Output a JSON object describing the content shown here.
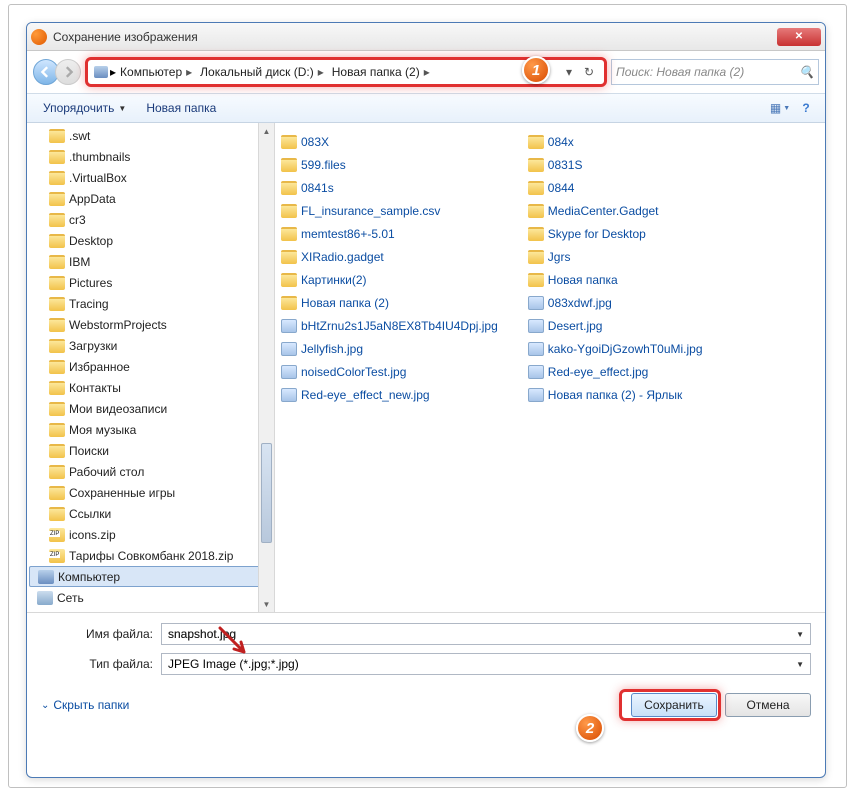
{
  "window": {
    "title": "Сохранение изображения"
  },
  "breadcrumbs": [
    "Компьютер",
    "Локальный диск (D:)",
    "Новая папка (2)"
  ],
  "search": {
    "placeholder": "Поиск: Новая папка (2)"
  },
  "toolbar": {
    "organize": "Упорядочить",
    "new_folder": "Новая папка"
  },
  "tree": [
    {
      "name": ".swt",
      "icon": "folder"
    },
    {
      "name": ".thumbnails",
      "icon": "folder"
    },
    {
      "name": ".VirtualBox",
      "icon": "folder"
    },
    {
      "name": "AppData",
      "icon": "folder"
    },
    {
      "name": "cr3",
      "icon": "folder"
    },
    {
      "name": "Desktop",
      "icon": "folder"
    },
    {
      "name": "IBM",
      "icon": "folder"
    },
    {
      "name": "Pictures",
      "icon": "folder"
    },
    {
      "name": "Tracing",
      "icon": "folder"
    },
    {
      "name": "WebstormProjects",
      "icon": "folder"
    },
    {
      "name": "Загрузки",
      "icon": "folder"
    },
    {
      "name": "Избранное",
      "icon": "folder"
    },
    {
      "name": "Контакты",
      "icon": "folder"
    },
    {
      "name": "Мои видеозаписи",
      "icon": "folder"
    },
    {
      "name": "Моя музыка",
      "icon": "folder"
    },
    {
      "name": "Поиски",
      "icon": "folder"
    },
    {
      "name": "Рабочий стол",
      "icon": "folder"
    },
    {
      "name": "Сохраненные игры",
      "icon": "folder"
    },
    {
      "name": "Ссылки",
      "icon": "folder"
    },
    {
      "name": "icons.zip",
      "icon": "zip"
    },
    {
      "name": "Тарифы Совкомбанк 2018.zip",
      "icon": "zip"
    },
    {
      "name": "Компьютер",
      "icon": "computer",
      "sel": true,
      "lvl": 1
    },
    {
      "name": "Сеть",
      "icon": "network",
      "lvl": 1
    }
  ],
  "files_col1": [
    {
      "name": "083X",
      "icon": "folder"
    },
    {
      "name": "599.files",
      "icon": "folder"
    },
    {
      "name": "0841s",
      "icon": "folder"
    },
    {
      "name": "FL_insurance_sample.csv",
      "icon": "folder"
    },
    {
      "name": "memtest86+-5.01",
      "icon": "folder"
    },
    {
      "name": "XIRadio.gadget",
      "icon": "folder"
    },
    {
      "name": "Картинки(2)",
      "icon": "folder"
    },
    {
      "name": "Новая папка (2)",
      "icon": "folder"
    },
    {
      "name": "bHtZrnu2s1J5aN8EX8Tb4IU4Dpj.jpg",
      "icon": "jpg"
    },
    {
      "name": "Jellyfish.jpg",
      "icon": "jpg"
    },
    {
      "name": "noisedColorTest.jpg",
      "icon": "jpg"
    },
    {
      "name": "Red-eye_effect_new.jpg",
      "icon": "jpg"
    }
  ],
  "files_col2": [
    {
      "name": "084x",
      "icon": "folder"
    },
    {
      "name": "0831S",
      "icon": "folder"
    },
    {
      "name": "0844",
      "icon": "folder"
    },
    {
      "name": "MediaCenter.Gadget",
      "icon": "folder"
    },
    {
      "name": "Skype for Desktop",
      "icon": "folder"
    },
    {
      "name": "Jgrs",
      "icon": "folder"
    },
    {
      "name": "Новая папка",
      "icon": "folder"
    },
    {
      "name": "083xdwf.jpg",
      "icon": "jpg"
    },
    {
      "name": "Desert.jpg",
      "icon": "jpg"
    },
    {
      "name": "kako-YgoiDjGzowhT0uMi.jpg",
      "icon": "jpg"
    },
    {
      "name": "Red-eye_effect.jpg",
      "icon": "jpg"
    },
    {
      "name": "Новая папка (2) - Ярлык",
      "icon": "jpg"
    }
  ],
  "form": {
    "filename_label": "Имя файла:",
    "filename_value": "snapshot.jpg",
    "filetype_label": "Тип файла:",
    "filetype_value": "JPEG Image (*.jpg;*.jpg)"
  },
  "buttons": {
    "hide": "Скрыть папки",
    "save": "Сохранить",
    "cancel": "Отмена"
  },
  "badges": {
    "one": "1",
    "two": "2"
  }
}
